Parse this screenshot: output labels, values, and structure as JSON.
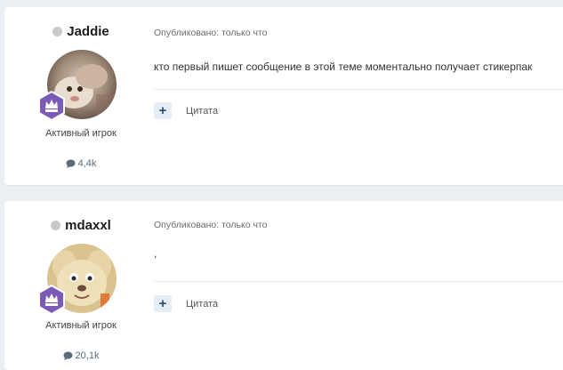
{
  "posts": [
    {
      "author": "Jaddie",
      "rank": "Активный игрок",
      "post_count": "4,4k",
      "published": "Опубликовано: только что",
      "content": "кто первый пишет сообщение в этой теме моментально получает стикерпак",
      "quote_label": "Цитата",
      "quote_icon": "+"
    },
    {
      "author": "mdaxxl",
      "rank": "Активный игрок",
      "post_count": "20,1k",
      "published": "Опубликовано: только что",
      "content": ",",
      "quote_label": "Цитата",
      "quote_icon": "+"
    }
  ],
  "colors": {
    "page_bg": "#ebeef2",
    "card_bg": "#ffffff",
    "status_offline": "#c9c9c9",
    "badge_purple": "#7b5bb5",
    "quote_button_bg": "#e7edf5"
  }
}
